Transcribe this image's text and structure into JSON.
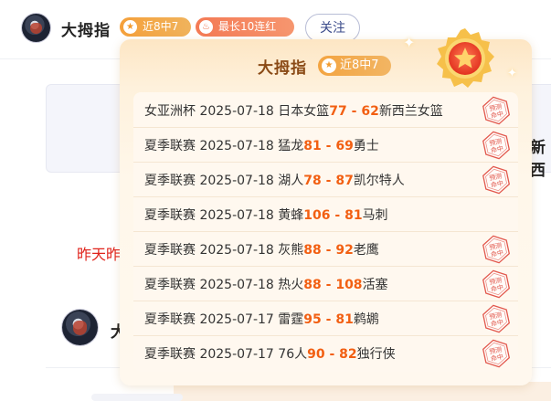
{
  "header": {
    "username": "大拇指",
    "streak_badge": "近8中7",
    "best_badge": "最长10连红",
    "follow_label": "关注"
  },
  "background": {
    "peek_text": "新西",
    "red_text": "昨天昨",
    "second_username": "大"
  },
  "popup": {
    "title": "大拇指",
    "badge": "近8中7",
    "stamp_text": "预测命中",
    "matches": [
      {
        "league": "女亚洲杯",
        "date": "2025-07-18",
        "home": "日本女篮",
        "home_score": "77",
        "away_score": "62",
        "away": "新西兰女篮",
        "hit": true
      },
      {
        "league": "夏季联赛",
        "date": "2025-07-18",
        "home": "猛龙",
        "home_score": "81",
        "away_score": "69",
        "away": "勇士",
        "hit": true
      },
      {
        "league": "夏季联赛",
        "date": "2025-07-18",
        "home": "湖人",
        "home_score": "78",
        "away_score": "87",
        "away": "凯尔特人",
        "hit": true
      },
      {
        "league": "夏季联赛",
        "date": "2025-07-18",
        "home": "黄蜂",
        "home_score": "106",
        "away_score": "81",
        "away": "马刺",
        "hit": false
      },
      {
        "league": "夏季联赛",
        "date": "2025-07-18",
        "home": "灰熊",
        "home_score": "88",
        "away_score": "92",
        "away": "老鹰",
        "hit": true
      },
      {
        "league": "夏季联赛",
        "date": "2025-07-18",
        "home": "热火",
        "home_score": "88",
        "away_score": "108",
        "away": "活塞",
        "hit": true
      },
      {
        "league": "夏季联赛",
        "date": "2025-07-17",
        "home": "雷霆",
        "home_score": "95",
        "away_score": "81",
        "away": "鹈鹕",
        "hit": true
      },
      {
        "league": "夏季联赛",
        "date": "2025-07-17",
        "home": "76人",
        "home_score": "90",
        "away_score": "82",
        "away": "独行侠",
        "hit": true
      }
    ]
  },
  "colors": {
    "score": "#f25f12",
    "stamp": "#e2574c",
    "title": "#8a4a16"
  }
}
